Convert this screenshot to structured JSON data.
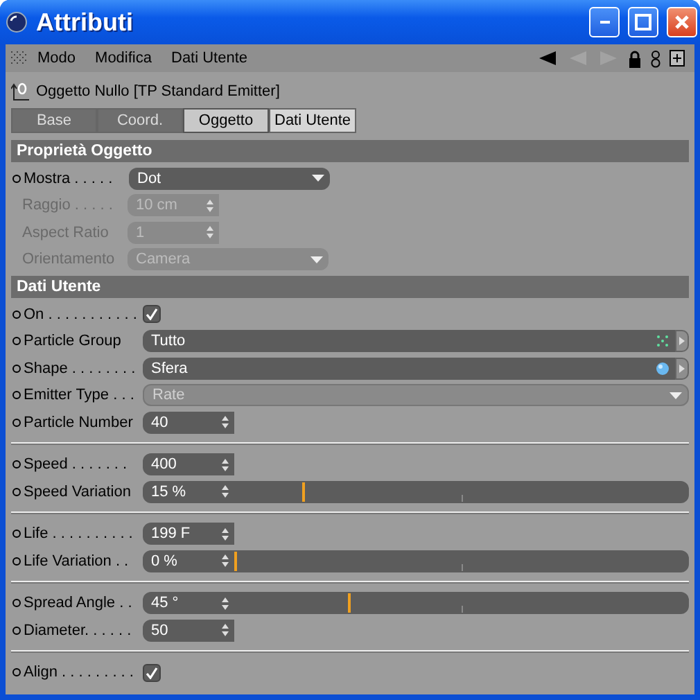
{
  "window": {
    "title": "Attributi"
  },
  "menu": [
    "Modo",
    "Modifica",
    "Dati Utente"
  ],
  "object": {
    "label": "Oggetto Nullo [TP Standard Emitter]"
  },
  "tabs": [
    {
      "label": "Base",
      "selected": false,
      "disabled": true
    },
    {
      "label": "Coord.",
      "selected": false,
      "disabled": true
    },
    {
      "label": "Oggetto",
      "selected": true,
      "disabled": false
    },
    {
      "label": "Dati Utente",
      "selected": false,
      "disabled": false
    }
  ],
  "sections": [
    {
      "title": "Proprietà Oggetto",
      "rows": [
        {
          "kind": "dropdown",
          "label": "Mostra . . . . .",
          "value": "Dot",
          "disabled": false
        },
        {
          "kind": "number",
          "label": "Raggio . . . . .",
          "value": "10 cm",
          "disabled": true
        },
        {
          "kind": "number",
          "label": "Aspect Ratio",
          "value": "1",
          "disabled": true
        },
        {
          "kind": "dropdown",
          "label": "Orientamento",
          "value": "Camera",
          "disabled": true
        }
      ]
    },
    {
      "title": "Dati Utente",
      "rows": [
        {
          "kind": "checkbox",
          "label": "On . . . . . . . . . . .",
          "checked": true,
          "disabled": false
        },
        {
          "kind": "grouplink",
          "label": "Particle Group",
          "value": "Tutto",
          "disabled": false
        },
        {
          "kind": "shapelink",
          "label": "Shape . . . . . . . .",
          "value": "Sfera",
          "disabled": false
        },
        {
          "kind": "menu",
          "label": "Emitter Type . . .",
          "value": "Rate",
          "disabled": false
        },
        {
          "kind": "number",
          "label": "Particle Number",
          "value": "40",
          "disabled": false
        },
        {
          "kind": "separator"
        },
        {
          "kind": "number",
          "label": "Speed . . . . . . .",
          "value": "400",
          "disabled": false
        },
        {
          "kind": "slider",
          "label": "Speed Variation",
          "value": "15 %",
          "level": 0.15,
          "disabled": false
        },
        {
          "kind": "separator"
        },
        {
          "kind": "number",
          "label": "Life . . . . . . . . . .",
          "value": "199 F",
          "disabled": false
        },
        {
          "kind": "slider",
          "label": "Life Variation . .",
          "value": "0 %",
          "level": 0,
          "disabled": false
        },
        {
          "kind": "separator"
        },
        {
          "kind": "slider",
          "label": "Spread Angle . .",
          "value": "45 °",
          "level": 0.25,
          "disabled": false
        },
        {
          "kind": "number",
          "label": "Diameter. . . . . .",
          "value": "50",
          "disabled": false
        },
        {
          "kind": "separator"
        },
        {
          "kind": "checkbox",
          "label": "Align . . . . . . . . .",
          "checked": true,
          "disabled": false
        }
      ]
    }
  ]
}
